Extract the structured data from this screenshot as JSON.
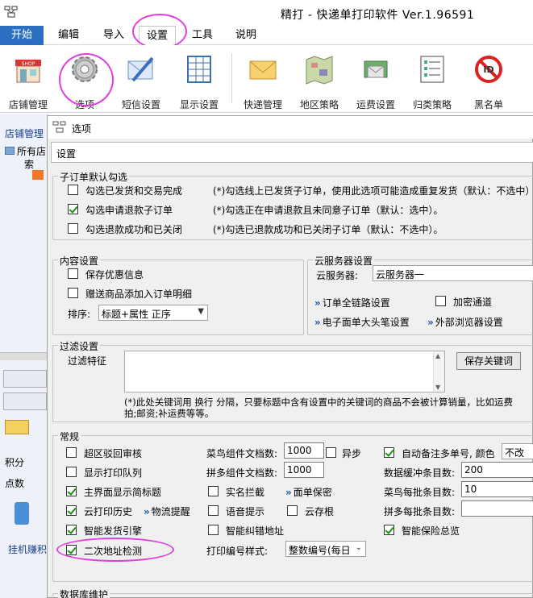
{
  "window": {
    "title": "精打 - 快递单打印软件 Ver.1.96591"
  },
  "tabs": [
    {
      "label": "开始"
    },
    {
      "label": "编辑"
    },
    {
      "label": "导入"
    },
    {
      "label": "设置"
    },
    {
      "label": "工具"
    },
    {
      "label": "说明"
    }
  ],
  "toolbar": [
    {
      "label": "店铺管理",
      "icon": "shop-icon"
    },
    {
      "label": "选项",
      "icon": "gear-icon"
    },
    {
      "label": "短信设置",
      "icon": "sms-settings-icon"
    },
    {
      "label": "显示设置",
      "icon": "display-settings-icon"
    },
    {
      "label": "快递管理",
      "icon": "envelope-icon"
    },
    {
      "label": "地区策略",
      "icon": "map-icon"
    },
    {
      "label": "运费设置",
      "icon": "money-envelope-icon"
    },
    {
      "label": "归类策略",
      "icon": "list-icon"
    },
    {
      "label": "黑名单",
      "icon": "no-entry-icon"
    }
  ],
  "left_panel": {
    "title": "店铺管理",
    "tree_root": "所有店",
    "tree_child": "索",
    "label_points": "积分",
    "label_score": "点数",
    "bottom_text": "挂机赚积"
  },
  "dialog": {
    "title": "选项",
    "tab": "设置",
    "sub_order": {
      "title": "子订单默认勾选",
      "items": [
        {
          "label": "勾选已发货和交易完成",
          "checked": false,
          "note": "(*)勾选线上已发货子订单，使用此选项可能造成重复发货（默认：不选中）"
        },
        {
          "label": "勾选申请退款子订单",
          "checked": true,
          "note": "(*)勾选正在申请退款且未同意子订单（默认：选中）。"
        },
        {
          "label": "勾选退款成功和已关闭",
          "checked": false,
          "note": "(*)勾选已退款成功和已关闭子订单（默认：不选中）。"
        }
      ]
    },
    "content": {
      "title": "内容设置",
      "save_discount": "保存优惠信息",
      "gift_to_detail": "赠送商品添加入订单明细",
      "sort_label": "排序:",
      "sort_value": "标题+属性 正序"
    },
    "cloud": {
      "title": "云服务器设置",
      "server_label": "云服务器:",
      "server_value": "云服务器一",
      "order_trace": "订单全链路设置",
      "encrypt_channel": "加密通道",
      "eface_pen": "电子面单大头笔设置",
      "external_browser": "外部浏览器设置"
    },
    "filter": {
      "title": "过滤设置",
      "label": "过滤特征",
      "save_button": "保存关键词",
      "note_line1": "(*)此处关键词用 换行 分隔，只要标题中含有设置中的关键词的商品不会被计算销量，比如运费",
      "note_line2": "拍;邮资;补运费等等。"
    },
    "general": {
      "title": "常规",
      "col1": [
        {
          "label": "超区驳回审核",
          "checked": false
        },
        {
          "label": "显示打印队列",
          "checked": false
        },
        {
          "label": "主界面显示简标题",
          "checked": true
        },
        {
          "label": "云打印历史",
          "checked": true
        },
        {
          "label": "智能发货引擎",
          "checked": true
        },
        {
          "label": "二次地址检测",
          "checked": true
        }
      ],
      "logistics_remind": "物流提醒",
      "cainiao_doc_label": "菜鸟组件文档数:",
      "cainiao_doc_value": "1000",
      "async_label": "异步",
      "pdd_doc_label": "拼多组件文档数:",
      "pdd_doc_value": "1000",
      "real_name_intercept": "实名拦截",
      "face_sheet_secret": "面单保密",
      "voice_tip": "语音提示",
      "cloud_save": "云存根",
      "smart_address_correct": "智能纠错地址",
      "print_no_style_label": "打印编号样式:",
      "print_no_style_value": "整数编号(每日",
      "auto_remark_label": "自动备注多单号, 颜色",
      "auto_remark_checked": true,
      "auto_remark_color": "不改",
      "buffer_label": "数据缓冲条目数:",
      "buffer_value": "200",
      "cainiao_batch_label": "菜鸟每批条目数:",
      "cainiao_batch_value": "10",
      "pdd_batch_label": "拼多每批条目数:",
      "pdd_batch_value": "",
      "smart_insure": "智能保险总览",
      "smart_insure_checked": true
    },
    "db_title": "数据库维护"
  }
}
